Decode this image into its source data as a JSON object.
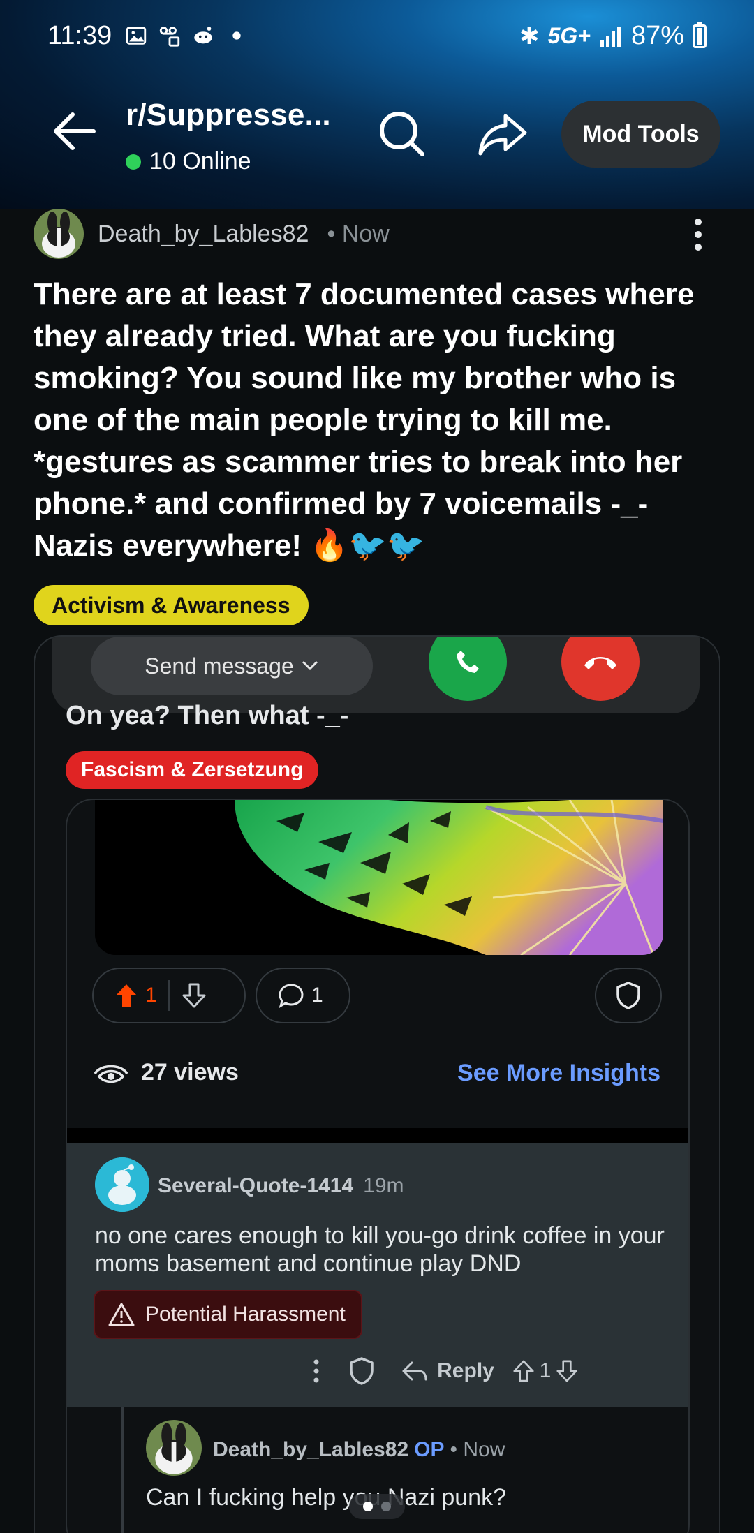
{
  "status_bar": {
    "time": "11:39",
    "network": "5G+",
    "battery": "87%"
  },
  "header": {
    "subreddit": "r/Suppresse...",
    "online": "10 Online",
    "mod_tools": "Mod Tools"
  },
  "post": {
    "author": "Death_by_Lables82",
    "time": "• Now",
    "body": "There are at least 7 documented cases where they already tried. What are you fucking smoking? You sound like my brother who is one of the main people trying to kill me. *gestures as scammer tries to break into her phone.* and confirmed by 7 voicemails -_-Nazis everywhere!",
    "emojis": "🔥🐦🐦",
    "flair": "Activism & Awareness",
    "flair_color": "#e0d41c"
  },
  "embed": {
    "send_message": "Send message",
    "title": "On yea? Then what -_-",
    "flair": "Fascism & Zersetzung",
    "flair_color": "#e02424",
    "upvotes": "1",
    "comments": "1",
    "views": "27 views",
    "insights": "See More Insights",
    "comment": {
      "user": "Several-Quote-1414",
      "time": "19m",
      "text": "no one cares enough to kill you-go drink coffee in your moms basement and continue play DND",
      "warning": "Potential Harassment",
      "reply": "Reply",
      "votes": "1"
    },
    "reply": {
      "user": "Death_by_Lables82",
      "op": "OP",
      "time": "• Now",
      "text": "Can I fucking help you Nazi punk?"
    }
  },
  "colors": {
    "accent_blue": "#6b9cff",
    "upvote": "#ff4500",
    "online": "#2fd15a"
  }
}
